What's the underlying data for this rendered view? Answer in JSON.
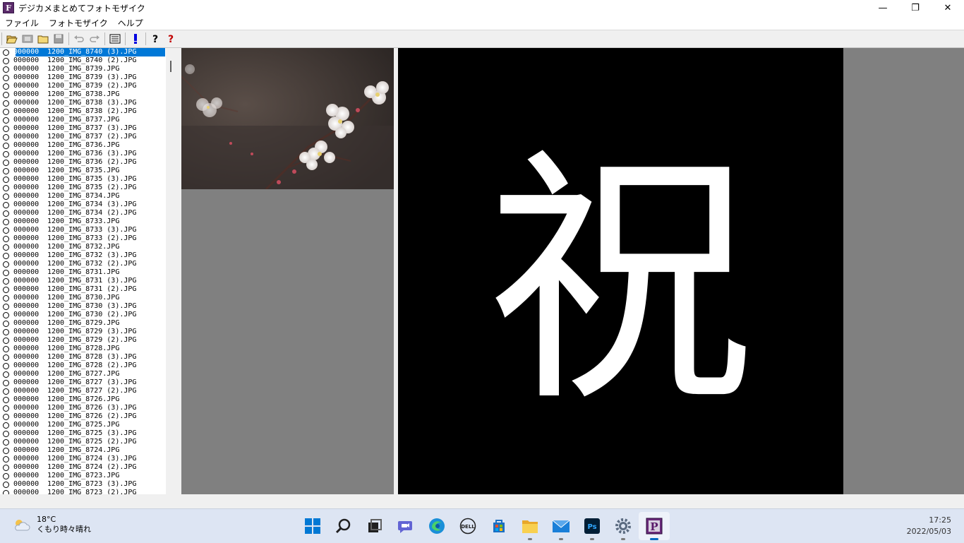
{
  "window": {
    "title": "デジカメまとめてフォトモザイク",
    "app_icon_letter": "F",
    "minimize": "—",
    "maximize": "❐",
    "close": "✕"
  },
  "menu": [
    "ファイル",
    "フォトモザイク",
    "ヘルプ"
  ],
  "toolbar_icons": [
    "open-folder-icon",
    "film-icon",
    "folder-icon",
    "save-icon",
    "undo-icon",
    "redo-icon",
    "list-icon",
    "exclamation-icon",
    "help-icon",
    "context-help-icon"
  ],
  "file_list": {
    "selected_index": 0,
    "items": [
      {
        "code": "000000",
        "name": "1200_IMG_8740 (3).JPG"
      },
      {
        "code": "000000",
        "name": "1200_IMG_8740 (2).JPG"
      },
      {
        "code": "000000",
        "name": "1200_IMG_8739.JPG"
      },
      {
        "code": "000000",
        "name": "1200_IMG_8739 (3).JPG"
      },
      {
        "code": "000000",
        "name": "1200_IMG_8739 (2).JPG"
      },
      {
        "code": "000000",
        "name": "1200_IMG_8738.JPG"
      },
      {
        "code": "000000",
        "name": "1200_IMG_8738 (3).JPG"
      },
      {
        "code": "000000",
        "name": "1200_IMG_8738 (2).JPG"
      },
      {
        "code": "000000",
        "name": "1200_IMG_8737.JPG"
      },
      {
        "code": "000000",
        "name": "1200_IMG_8737 (3).JPG"
      },
      {
        "code": "000000",
        "name": "1200_IMG_8737 (2).JPG"
      },
      {
        "code": "000000",
        "name": "1200_IMG_8736.JPG"
      },
      {
        "code": "000000",
        "name": "1200_IMG_8736 (3).JPG"
      },
      {
        "code": "000000",
        "name": "1200_IMG_8736 (2).JPG"
      },
      {
        "code": "000000",
        "name": "1200_IMG_8735.JPG"
      },
      {
        "code": "000000",
        "name": "1200_IMG_8735 (3).JPG"
      },
      {
        "code": "000000",
        "name": "1200_IMG_8735 (2).JPG"
      },
      {
        "code": "000000",
        "name": "1200_IMG_8734.JPG"
      },
      {
        "code": "000000",
        "name": "1200_IMG_8734 (3).JPG"
      },
      {
        "code": "000000",
        "name": "1200_IMG_8734 (2).JPG"
      },
      {
        "code": "000000",
        "name": "1200_IMG_8733.JPG"
      },
      {
        "code": "000000",
        "name": "1200_IMG_8733 (3).JPG"
      },
      {
        "code": "000000",
        "name": "1200_IMG_8733 (2).JPG"
      },
      {
        "code": "000000",
        "name": "1200_IMG_8732.JPG"
      },
      {
        "code": "000000",
        "name": "1200_IMG_8732 (3).JPG"
      },
      {
        "code": "000000",
        "name": "1200_IMG_8732 (2).JPG"
      },
      {
        "code": "000000",
        "name": "1200_IMG_8731.JPG"
      },
      {
        "code": "000000",
        "name": "1200_IMG_8731 (3).JPG"
      },
      {
        "code": "000000",
        "name": "1200_IMG_8731 (2).JPG"
      },
      {
        "code": "000000",
        "name": "1200_IMG_8730.JPG"
      },
      {
        "code": "000000",
        "name": "1200_IMG_8730 (3).JPG"
      },
      {
        "code": "000000",
        "name": "1200_IMG_8730 (2).JPG"
      },
      {
        "code": "000000",
        "name": "1200_IMG_8729.JPG"
      },
      {
        "code": "000000",
        "name": "1200_IMG_8729 (3).JPG"
      },
      {
        "code": "000000",
        "name": "1200_IMG_8729 (2).JPG"
      },
      {
        "code": "000000",
        "name": "1200_IMG_8728.JPG"
      },
      {
        "code": "000000",
        "name": "1200_IMG_8728 (3).JPG"
      },
      {
        "code": "000000",
        "name": "1200_IMG_8728 (2).JPG"
      },
      {
        "code": "000000",
        "name": "1200_IMG_8727.JPG"
      },
      {
        "code": "000000",
        "name": "1200_IMG_8727 (3).JPG"
      },
      {
        "code": "000000",
        "name": "1200_IMG_8727 (2).JPG"
      },
      {
        "code": "000000",
        "name": "1200_IMG_8726.JPG"
      },
      {
        "code": "000000",
        "name": "1200_IMG_8726 (3).JPG"
      },
      {
        "code": "000000",
        "name": "1200_IMG_8726 (2).JPG"
      },
      {
        "code": "000000",
        "name": "1200_IMG_8725.JPG"
      },
      {
        "code": "000000",
        "name": "1200_IMG_8725 (3).JPG"
      },
      {
        "code": "000000",
        "name": "1200_IMG_8725 (2).JPG"
      },
      {
        "code": "000000",
        "name": "1200_IMG_8724.JPG"
      },
      {
        "code": "000000",
        "name": "1200_IMG_8724 (3).JPG"
      },
      {
        "code": "000000",
        "name": "1200_IMG_8724 (2).JPG"
      },
      {
        "code": "000000",
        "name": "1200_IMG_8723.JPG"
      },
      {
        "code": "000000",
        "name": "1200_IMG_8723 (3).JPG"
      },
      {
        "code": "000000",
        "name": "1200_IMG_8723 (2).JPG"
      }
    ]
  },
  "mosaic": {
    "character": "祝",
    "background": "#000000",
    "foreground": "#ffffff"
  },
  "taskbar": {
    "weather_temp": "18°C",
    "weather_desc": "くもり時々晴れ",
    "time": "17:25",
    "date": "2022/05/03",
    "apps": [
      "start-icon",
      "search-icon",
      "task-view-icon",
      "chat-icon",
      "edge-icon",
      "dell-icon",
      "store-icon",
      "file-explorer-icon",
      "mail-icon",
      "photoshop-icon",
      "settings-icon",
      "photomosaic-app-icon"
    ],
    "running": [
      false,
      false,
      false,
      false,
      false,
      false,
      false,
      true,
      true,
      true,
      true,
      true
    ],
    "active_app": "photomosaic-app-icon"
  },
  "colors": {
    "selection": "#0078d7",
    "panel_gray": "#808080",
    "taskbar": "#dde5f3",
    "accent": "#0067c0"
  }
}
